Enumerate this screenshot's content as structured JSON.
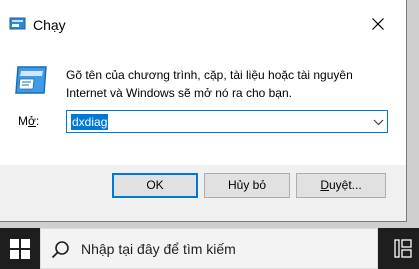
{
  "dialog": {
    "title": "Chạy",
    "description": "Gõ tên của chương trình, cặp, tài liệu hoặc tài nguyên Internet và Windows sẽ mở nó ra cho bạn.",
    "open_label_prefix": "M",
    "open_label_underlined": "ở",
    "open_label_suffix": ":",
    "open_value": "dxdiag",
    "ok_label": "OK",
    "cancel_label": "Hủy bỏ",
    "browse_label_underlined": "D",
    "browse_label_rest": "uyệt..."
  },
  "taskbar": {
    "search_placeholder": "Nhập tại đây để tìm kiếm"
  },
  "colors": {
    "accent": "#0078d7",
    "dialog_bg": "#f0f0f0",
    "taskbar_bg": "#1e1e1e"
  }
}
